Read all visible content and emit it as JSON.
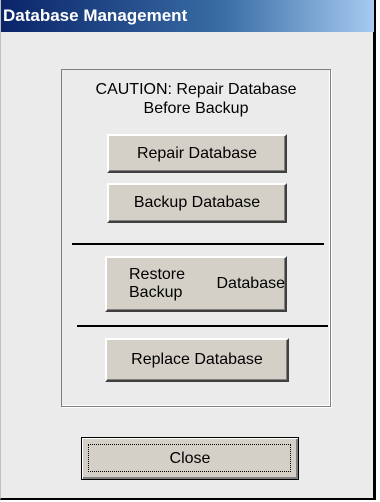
{
  "window": {
    "title": "Database Management"
  },
  "group": {
    "caution_line1": "CAUTION: Repair Database",
    "caution_line2": "Before Backup"
  },
  "buttons": {
    "repair": "Repair Database",
    "backup": "Backup Database",
    "restore_line1": "Restore Backup",
    "restore_line2": "Database",
    "replace": "Replace Database",
    "close": "Close"
  },
  "colors": {
    "titlebar_start": "#0a246a",
    "titlebar_end": "#a6caf0",
    "window_background": "#ebebeb",
    "button_face": "#d4d0c8"
  }
}
